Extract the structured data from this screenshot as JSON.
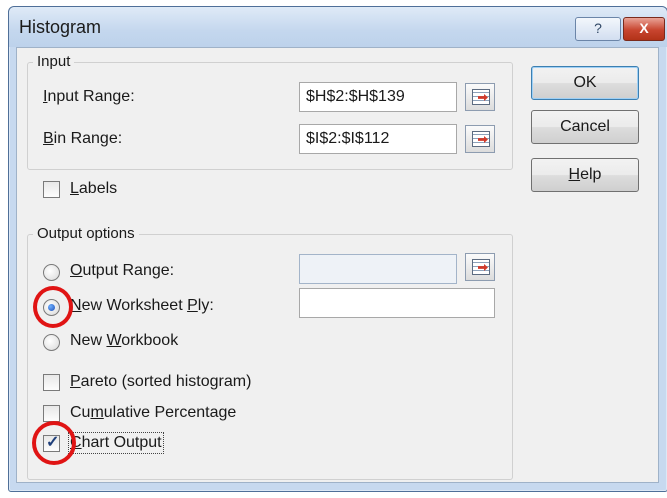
{
  "window": {
    "title": "Histogram",
    "help_glyph": "?",
    "close_glyph": "X"
  },
  "input_group": {
    "legend": "Input",
    "input_range_label": "Input Range:",
    "input_range_value": "$H$2:$H$139",
    "bin_range_label": "Bin Range:",
    "bin_range_value": "$I$2:$I$112"
  },
  "labels_checkbox": {
    "label": "Labels",
    "checked": false
  },
  "output_group": {
    "legend": "Output options",
    "output_range_label": "Output Range:",
    "output_range_value": "",
    "new_worksheet_label": "New Worksheet Ply:",
    "new_worksheet_value": "",
    "new_workbook_label": "New Workbook",
    "selected_option": "New Worksheet Ply"
  },
  "options": {
    "pareto_label": "Pareto (sorted histogram)",
    "pareto_checked": false,
    "cumulative_label": "Cumulative Percentage",
    "cumulative_checked": false,
    "chart_output_label": "Chart Output",
    "chart_output_checked": true,
    "check_glyph": "✓"
  },
  "buttons": {
    "ok": "OK",
    "cancel": "Cancel",
    "help": "Help"
  },
  "colors": {
    "annotation_circle": "#e01414",
    "title_bar": "#c4d7ee",
    "dialog_face": "#f0f0f0"
  }
}
